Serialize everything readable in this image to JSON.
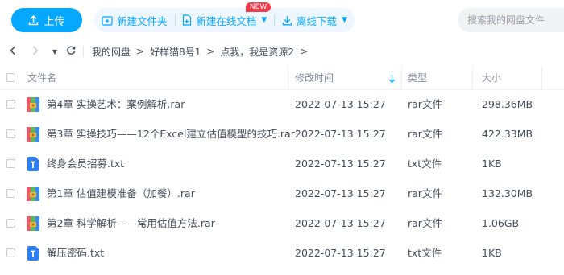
{
  "toolbar": {
    "upload_label": "上传",
    "new_folder_label": "新建文件夹",
    "new_online_doc_label": "新建在线文档",
    "new_badge": "NEW",
    "offline_download_label": "离线下载",
    "search_placeholder": "搜索我的网盘文件"
  },
  "breadcrumb": [
    "我的网盘",
    "好样猫8号1",
    "点我，我是资源2"
  ],
  "table": {
    "headers": {
      "name": "文件名",
      "modified": "修改时间",
      "type": "类型",
      "size": "大小"
    },
    "rows": [
      {
        "name": "第4章 实操艺术：案例解析.rar",
        "modified": "2022-07-13 15:27",
        "type": "rar文件",
        "size": "298.36MB",
        "icon": "rar-archive-icon"
      },
      {
        "name": "第3章 实操技巧——12个Excel建立估值模型的技巧.rar",
        "modified": "2022-07-13 15:27",
        "type": "rar文件",
        "size": "422.33MB",
        "icon": "rar-archive-icon"
      },
      {
        "name": "终身会员招募.txt",
        "modified": "2022-07-13 15:27",
        "type": "txt文件",
        "size": "1KB",
        "icon": "txt-file-icon"
      },
      {
        "name": "第1章 估值建模准备（加餐）.rar",
        "modified": "2022-07-13 15:27",
        "type": "rar文件",
        "size": "132.30MB",
        "icon": "rar-archive-icon"
      },
      {
        "name": "第2章 科学解析——常用估值方法.rar",
        "modified": "2022-07-13 15:27",
        "type": "rar文件",
        "size": "1.06GB",
        "icon": "rar-archive-icon"
      },
      {
        "name": "解压密码.txt",
        "modified": "2022-07-13 15:27",
        "type": "txt文件",
        "size": "1KB",
        "icon": "txt-file-icon"
      }
    ]
  },
  "colors": {
    "accent": "#06a7ff",
    "badge": "#f33b4b",
    "txt_icon": "#2e7ff6"
  }
}
